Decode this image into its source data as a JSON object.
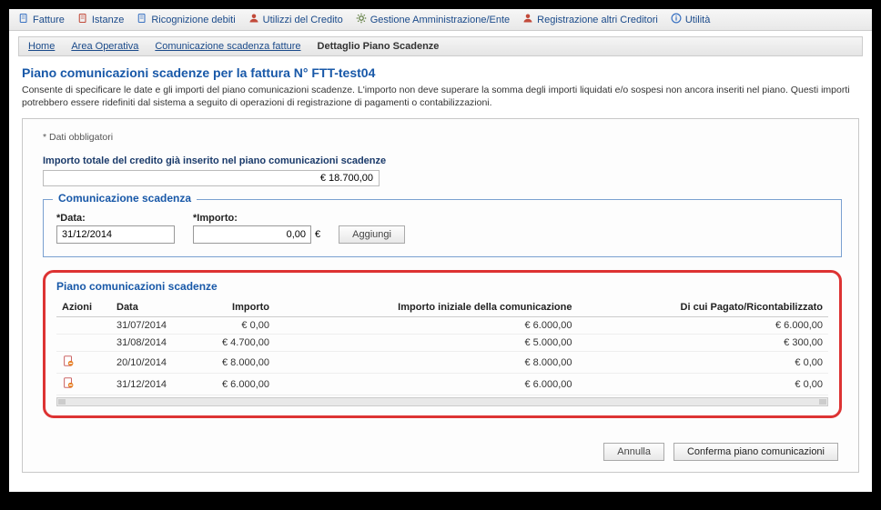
{
  "menu": [
    {
      "label": "Fatture",
      "icon": "doc"
    },
    {
      "label": "Istanze",
      "icon": "doc-red"
    },
    {
      "label": "Ricognizione debiti",
      "icon": "doc"
    },
    {
      "label": "Utilizzi del Credito",
      "icon": "user-red"
    },
    {
      "label": "Gestione Amministrazione/Ente",
      "icon": "gear"
    },
    {
      "label": "Registrazione altri Creditori",
      "icon": "user-red"
    },
    {
      "label": "Utilità",
      "icon": "info"
    }
  ],
  "breadcrumb": {
    "items": [
      {
        "label": "Home",
        "link": true
      },
      {
        "label": "Area Operativa",
        "link": true
      },
      {
        "label": "Comunicazione scadenza fatture",
        "link": true
      },
      {
        "label": "Dettaglio Piano Scadenze",
        "link": false
      }
    ]
  },
  "page": {
    "title": "Piano comunicazioni scadenze per la fattura N° FTT-test04",
    "desc": "Consente di specificare le date e gli importi del piano comunicazioni scadenze. L'importo non deve superare la somma degli importi liquidati e/o sospesi non ancora inseriti nel piano. Questi importi potrebbero essere ridefiniti dal sistema a seguito di operazioni di registrazione di pagamenti o contabilizzazioni."
  },
  "hint": "* Dati obbligatori",
  "total": {
    "label": "Importo totale del credito già inserito nel piano comunicazioni scadenze",
    "value": "€ 18.700,00"
  },
  "comunicazione": {
    "legend": "Comunicazione scadenza",
    "data_label": "*Data:",
    "data_value": "31/12/2014",
    "importo_label": "*Importo:",
    "importo_value": "0,00",
    "currency": "€",
    "aggiungi": "Aggiungi"
  },
  "plan": {
    "title": "Piano comunicazioni scadenze",
    "headers": {
      "azioni": "Azioni",
      "data": "Data",
      "importo": "Importo",
      "iniziale": "Importo iniziale della comunicazione",
      "pagato": "Di cui Pagato/Ricontabilizzato"
    },
    "rows": [
      {
        "has_action": false,
        "data": "31/07/2014",
        "importo": "€  0,00",
        "iniziale": "€  6.000,00",
        "pagato": "€  6.000,00"
      },
      {
        "has_action": false,
        "data": "31/08/2014",
        "importo": "€  4.700,00",
        "iniziale": "€  5.000,00",
        "pagato": "€  300,00"
      },
      {
        "has_action": true,
        "data": "20/10/2014",
        "importo": "€  8.000,00",
        "iniziale": "€  8.000,00",
        "pagato": "€  0,00"
      },
      {
        "has_action": true,
        "data": "31/12/2014",
        "importo": "€  6.000,00",
        "iniziale": "€  6.000,00",
        "pagato": "€  0,00"
      }
    ]
  },
  "footer": {
    "annulla": "Annulla",
    "conferma": "Conferma piano comunicazioni"
  }
}
